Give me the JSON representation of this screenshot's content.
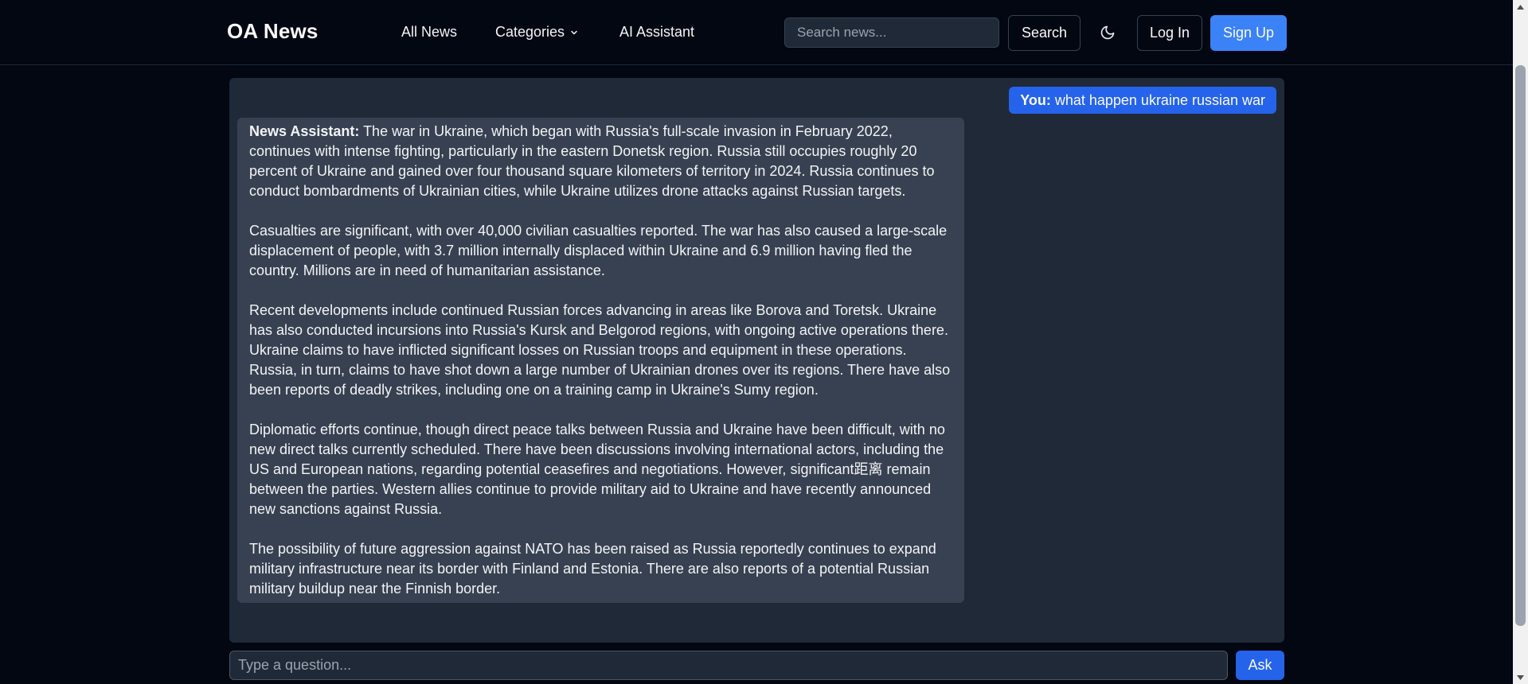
{
  "header": {
    "brand": "OA News",
    "nav": {
      "all_news": "All News",
      "categories": "Categories",
      "ai_assistant": "AI Assistant"
    },
    "search": {
      "placeholder": "Search news...",
      "value": "",
      "button_label": "Search"
    },
    "theme_icon": "moon-icon",
    "login_label": "Log In",
    "signup_label": "Sign Up"
  },
  "chat": {
    "user_message": {
      "speaker": "You:",
      "text": "what happen ukraine russian war"
    },
    "assistant_message": {
      "speaker": "News Assistant:",
      "paragraphs": [
        "The war in Ukraine, which began with Russia's full-scale invasion in February 2022, continues with intense fighting, particularly in the eastern Donetsk region. Russia still occupies roughly 20 percent of Ukraine and gained over four thousand square kilometers of territory in 2024. Russia continues to conduct bombardments of Ukrainian cities, while Ukraine utilizes drone attacks against Russian targets.",
        "Casualties are significant, with over 40,000 civilian casualties reported. The war has also caused a large-scale displacement of people, with 3.7 million internally displaced within Ukraine and 6.9 million having fled the country. Millions are in need of humanitarian assistance.",
        "Recent developments include continued Russian forces advancing in areas like Borova and Toretsk. Ukraine has also conducted incursions into Russia's Kursk and Belgorod regions, with ongoing active operations there. Ukraine claims to have inflicted significant losses on Russian troops and equipment in these operations. Russia, in turn, claims to have shot down a large number of Ukrainian drones over its regions. There have also been reports of deadly strikes, including one on a training camp in Ukraine's Sumy region.",
        "Diplomatic efforts continue, though direct peace talks between Russia and Ukraine have been difficult, with no new direct talks currently scheduled. There have been discussions involving international actors, including the US and European nations, regarding potential ceasefires and negotiations. However, significant距离 remain between the parties. Western allies continue to provide military aid to Ukraine and have recently announced new sanctions against Russia.",
        "The possibility of future aggression against NATO has been raised as Russia reportedly continues to expand military infrastructure near its border with Finland and Estonia. There are also reports of a potential Russian military buildup near the Finnish border."
      ]
    }
  },
  "ask": {
    "placeholder": "Type a question...",
    "value": "",
    "button_label": "Ask"
  },
  "colors": {
    "background": "#030712",
    "panel": "#1f2937",
    "assistant_bubble": "#374151",
    "accent": "#2563eb",
    "signup": "#3b82f6"
  }
}
